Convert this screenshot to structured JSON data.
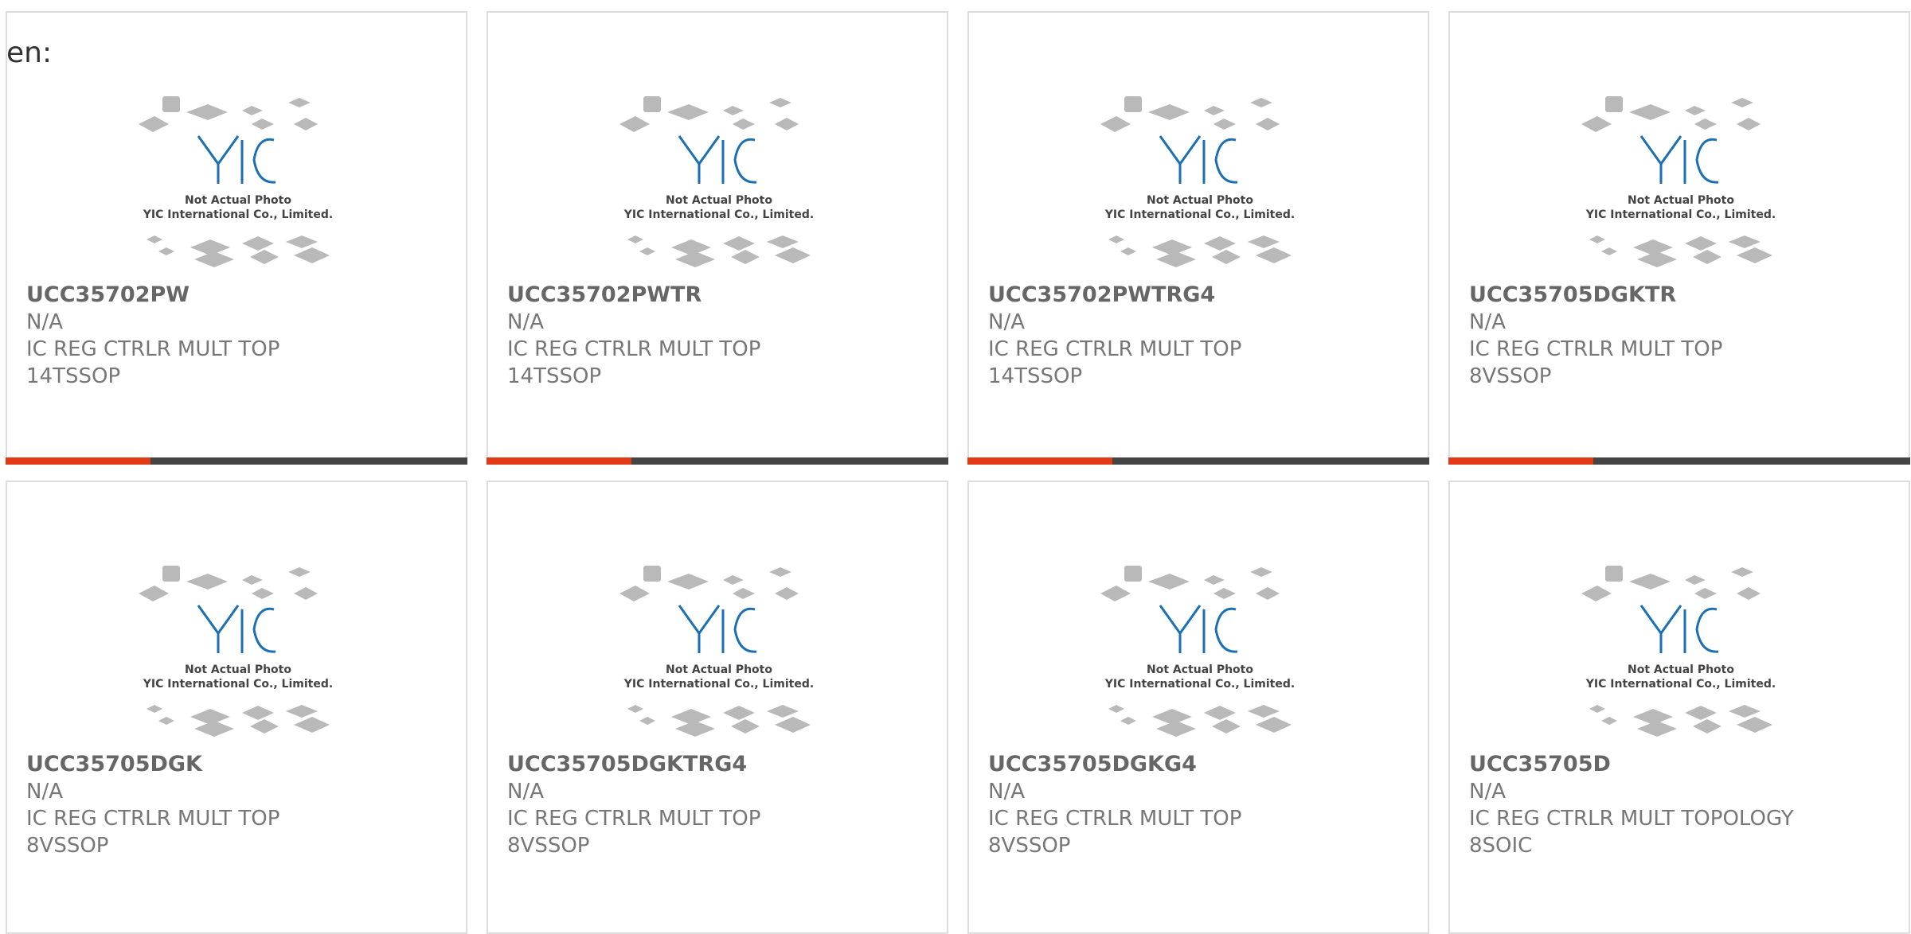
{
  "language_label": "en:",
  "colors": {
    "accent": "#e23a14",
    "dark_bar": "#444444",
    "logo_blue": "#1a6fb5",
    "chip_grey": "#b9b9b9"
  },
  "placeholder_image": {
    "caption_line1": "Not Actual Photo",
    "caption_line2": "YIC International Co., Limited.",
    "logo_text": "YIC"
  },
  "products": [
    {
      "part_number": "UCC35702PW",
      "manufacturer": "N/A",
      "description": "IC REG CTRLR MULT TOP",
      "package": "14TSSOP"
    },
    {
      "part_number": "UCC35702PWTR",
      "manufacturer": "N/A",
      "description": "IC REG CTRLR MULT TOP",
      "package": "14TSSOP"
    },
    {
      "part_number": "UCC35702PWTRG4",
      "manufacturer": "N/A",
      "description": "IC REG CTRLR MULT TOP",
      "package": "14TSSOP"
    },
    {
      "part_number": "UCC35705DGKTR",
      "manufacturer": "N/A",
      "description": "IC REG CTRLR MULT TOP",
      "package": "8VSSOP"
    },
    {
      "part_number": "UCC35705DGK",
      "manufacturer": "N/A",
      "description": "IC REG CTRLR MULT TOP",
      "package": "8VSSOP"
    },
    {
      "part_number": "UCC35705DGKTRG4",
      "manufacturer": "N/A",
      "description": "IC REG CTRLR MULT TOP",
      "package": "8VSSOP"
    },
    {
      "part_number": "UCC35705DGKG4",
      "manufacturer": "N/A",
      "description": "IC REG CTRLR MULT TOP",
      "package": "8VSSOP"
    },
    {
      "part_number": "UCC35705D",
      "manufacturer": "N/A",
      "description": "IC REG CTRLR MULT TOPOLOGY",
      "package": "8SOIC"
    }
  ]
}
